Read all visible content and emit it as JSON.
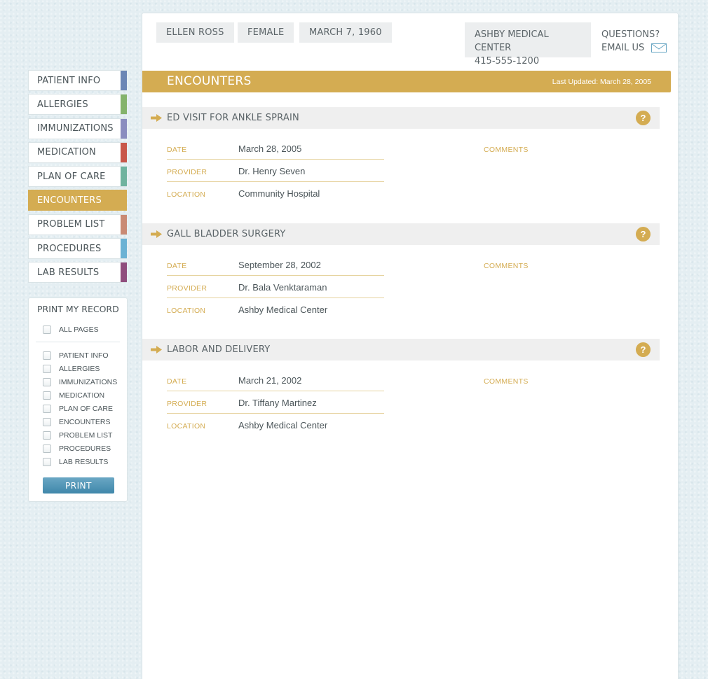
{
  "nav": {
    "items": [
      {
        "label": "PATIENT INFO",
        "color": "#6b86b5",
        "active": false
      },
      {
        "label": "ALLERGIES",
        "color": "#84b36c",
        "active": false
      },
      {
        "label": "IMMUNIZATIONS",
        "color": "#8a8dbf",
        "active": false
      },
      {
        "label": "MEDICATION",
        "color": "#c8574a",
        "active": false
      },
      {
        "label": "PLAN OF CARE",
        "color": "#6fb39f",
        "active": false
      },
      {
        "label": "ENCOUNTERS",
        "color": "#d4ac52",
        "active": true
      },
      {
        "label": "PROBLEM LIST",
        "color": "#c98a74",
        "active": false
      },
      {
        "label": "PROCEDURES",
        "color": "#6bb2d4",
        "active": false
      },
      {
        "label": "LAB RESULTS",
        "color": "#8f4d7d",
        "active": false
      }
    ]
  },
  "print": {
    "title": "PRINT MY RECORD",
    "all_pages": "ALL PAGES",
    "options": [
      "PATIENT INFO",
      "ALLERGIES",
      "IMMUNIZATIONS",
      "MEDICATION",
      "PLAN OF CARE",
      "ENCOUNTERS",
      "PROBLEM LIST",
      "PROCEDURES",
      "LAB RESULTS"
    ],
    "button": "PRINT"
  },
  "patient": {
    "name": "ELLEN ROSS",
    "sex": "FEMALE",
    "dob": "MARCH 7, 1960"
  },
  "facility": {
    "name": "ASHBY MEDICAL CENTER",
    "phone": "415-555-1200"
  },
  "contact": {
    "questions": "QUESTIONS?",
    "email": "EMAIL US"
  },
  "section": {
    "title": "ENCOUNTERS",
    "last_updated": "Last Updated: March 28, 2005"
  },
  "labels": {
    "date": "DATE",
    "provider": "PROVIDER",
    "location": "LOCATION",
    "comments": "COMMENTS"
  },
  "encounters": [
    {
      "title": "ED VISIT FOR ANKLE SPRAIN",
      "date": "March 28, 2005",
      "provider": "Dr. Henry Seven",
      "location": "Community Hospital"
    },
    {
      "title": "GALL BLADDER SURGERY",
      "date": "September 28, 2002",
      "provider": "Dr. Bala Venktaraman",
      "location": "Ashby Medical Center"
    },
    {
      "title": "LABOR AND DELIVERY",
      "date": "March 21, 2002",
      "provider": "Dr. Tiffany Martinez",
      "location": "Ashby Medical Center"
    }
  ],
  "accent": "#d4ac52"
}
